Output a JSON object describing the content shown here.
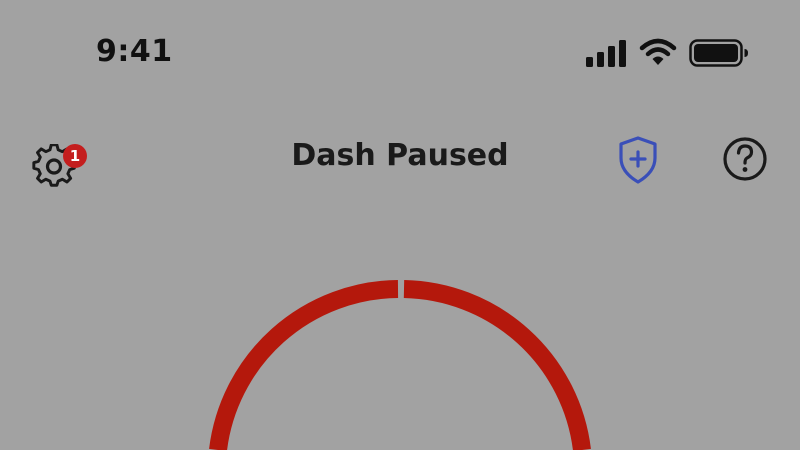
{
  "status_bar": {
    "time": "9:41",
    "icons": [
      "cellular-signal-icon",
      "wifi-icon",
      "battery-icon"
    ]
  },
  "nav": {
    "title": "Dash Paused",
    "settings": {
      "icon": "gear-icon",
      "badge_count": "1"
    },
    "safety": {
      "icon": "shield-plus-icon"
    },
    "help": {
      "icon": "question-circle-icon"
    }
  },
  "colors": {
    "background": "#a2a2a2",
    "ring": "#b4180c",
    "badge": "#c41e1e",
    "shield": "#3a4fb8",
    "text": "#1a1a1a"
  }
}
